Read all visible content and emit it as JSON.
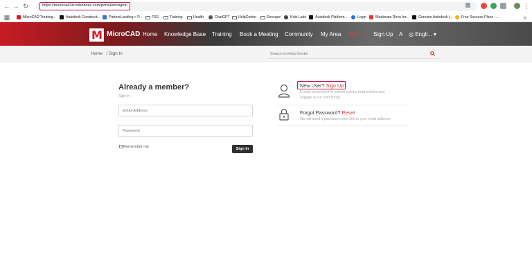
{
  "browser": {
    "url": "https://microcad3d.zohodesk.com/portal/en/signin"
  },
  "bookmarks": [
    "MicroCAD Training...",
    "Autodesk Construct...",
    "PartnerLanding » P...",
    "FSS",
    "Training",
    "Health",
    "ChatGPT",
    "HelpCenter",
    "Enscape",
    "Kobi Labs",
    "Autodesk Platform...",
    "Login",
    "Bluebeam Revu for...",
    "Genuine Autodesk |...",
    "Free Success Plans -..."
  ],
  "header": {
    "brand": "MicroCAD",
    "logo_letter": "M",
    "nav": [
      "Home",
      "Knowledge Base",
      "Training",
      "Book a Meeting",
      "Community",
      "My Area",
      "Sign In",
      "Sign Up",
      "A",
      "Engli..."
    ]
  },
  "breadcrumb": {
    "home": "Home",
    "sep": "/",
    "current": "Sign In"
  },
  "search": {
    "placeholder": "Search in Help Center"
  },
  "signin": {
    "title": "Already a member?",
    "subtitle": "Sign In",
    "email_placeholder": "Email Address",
    "password_placeholder": "Password",
    "remember": "Remember me",
    "button": "Sign In"
  },
  "new_user": {
    "label": "New User?",
    "link": "Sign Up",
    "desc1": "Create an account to submit tickets, read articles and",
    "desc2": "engage in our community."
  },
  "forgot": {
    "label": "Forgot Password?",
    "link": "Reset",
    "desc": "We will send a password reset link to your email address."
  },
  "colors": {
    "accent": "#d32f2f",
    "highlight": "#c2185b",
    "button": "#2f2f2f"
  }
}
